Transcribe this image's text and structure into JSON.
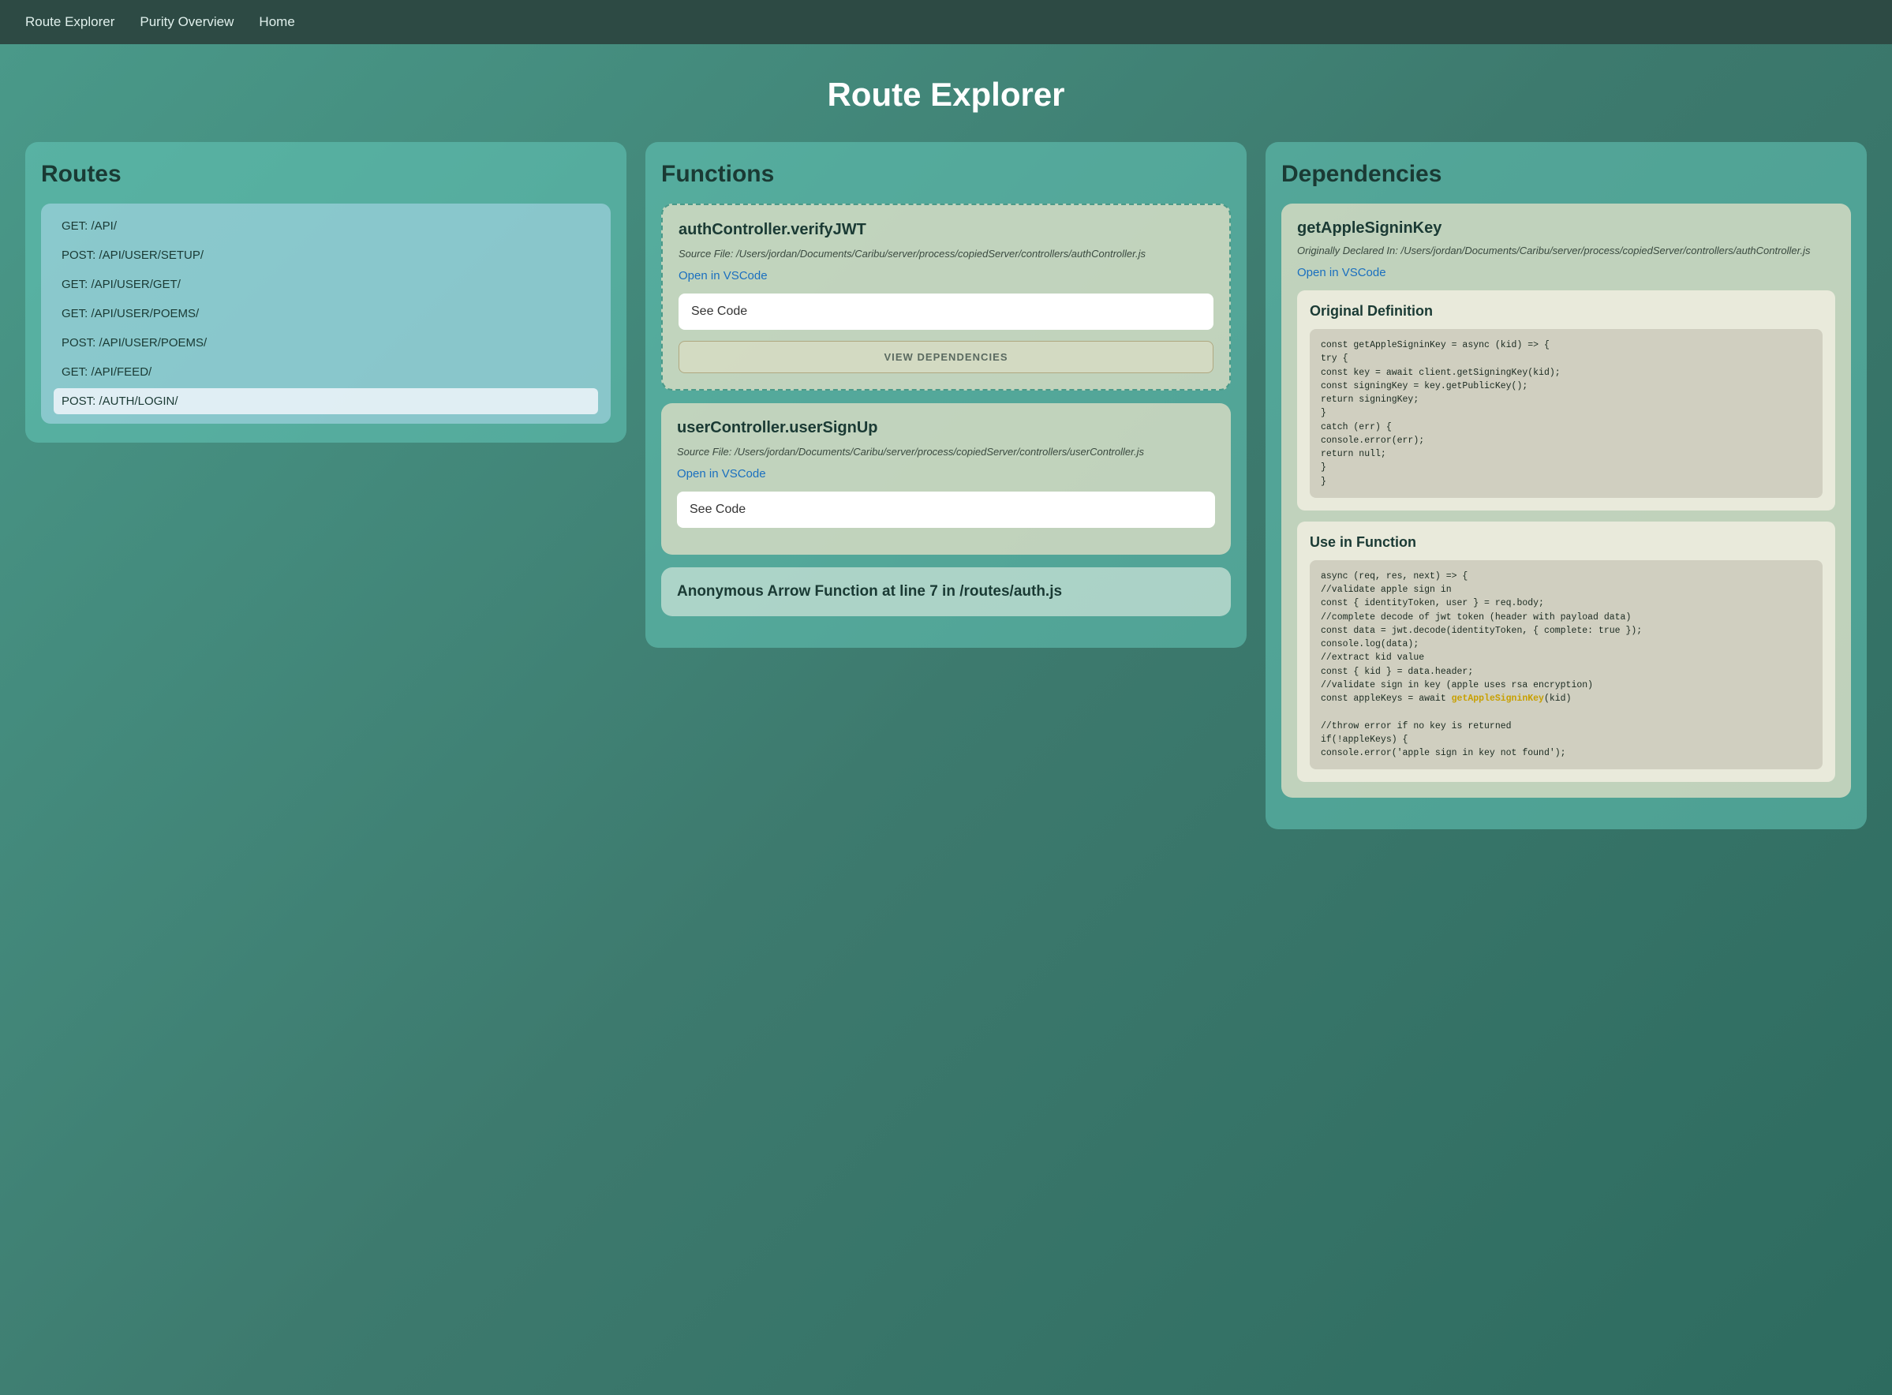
{
  "navbar": {
    "links": [
      {
        "label": "Route Explorer",
        "id": "route-explorer"
      },
      {
        "label": "Purity Overview",
        "id": "purity-overview"
      },
      {
        "label": "Home",
        "id": "home"
      }
    ]
  },
  "page": {
    "title": "Route Explorer"
  },
  "routes": {
    "column_title": "Routes",
    "items": [
      {
        "label": "GET: /API/",
        "active": false
      },
      {
        "label": "POST: /API/USER/SETUP/",
        "active": false
      },
      {
        "label": "GET: /API/USER/GET/",
        "active": false
      },
      {
        "label": "GET: /API/USER/POEMS/",
        "active": false
      },
      {
        "label": "POST: /API/USER/POEMS/",
        "active": false
      },
      {
        "label": "GET: /API/FEED/",
        "active": false
      },
      {
        "label": "POST: /AUTH/LOGIN/",
        "active": true
      }
    ]
  },
  "functions": {
    "column_title": "Functions",
    "items": [
      {
        "name": "authController.verifyJWT",
        "source": "Source File: /Users/jordan/Documents/Caribu/server/process/copiedServer/controllers/authController.js",
        "vscode_label": "Open in VSCode",
        "see_code_label": "See Code",
        "view_deps_label": "VIEW DEPENDENCIES",
        "selected": true
      },
      {
        "name": "userController.userSignUp",
        "source": "Source File: /Users/jordan/Documents/Caribu/server/process/copiedServer/controllers/userController.js",
        "vscode_label": "Open in VSCode",
        "see_code_label": "See Code",
        "selected": false
      },
      {
        "name": "Anonymous Arrow Function at line 7 in /routes/auth.js",
        "selected": false
      }
    ]
  },
  "dependencies": {
    "column_title": "Dependencies",
    "items": [
      {
        "name": "getAppleSigninKey",
        "declared": "Originally Declared In: /Users/jordan/Documents/Caribu/server/process/copiedServer/controllers/authController.js",
        "vscode_label": "Open in VSCode",
        "original_definition_label": "Original Definition",
        "original_definition_code": "const getAppleSigninKey = async (kid) => {\ntry {\nconst key = await client.getSigningKey(kid);\nconst signingKey = key.getPublicKey();\nreturn signingKey;\n}\ncatch (err) {\nconsole.error(err);\nreturn null;\n}\n}",
        "use_in_function_label": "Use in Function",
        "use_in_function_code": "async (req, res, next) => {\n//validate apple sign in\nconst { identityToken, user } = req.body;\n//complete decode of jwt token (header with payload data)\nconst data = jwt.decode(identityToken, { complete: true });\nconsole.log(data);\n//extract kid value\nconst { kid } = data.header;\n//validate sign in key (apple uses rsa encryption)\nconst appleKeys = await getAppleSigninKey(kid)\n\n//throw error if no key is returned\nif(!appleKeys) {\nconsole.error('apple sign in key not found');",
        "highlight_text": "getAppleSigninKey"
      }
    ]
  }
}
